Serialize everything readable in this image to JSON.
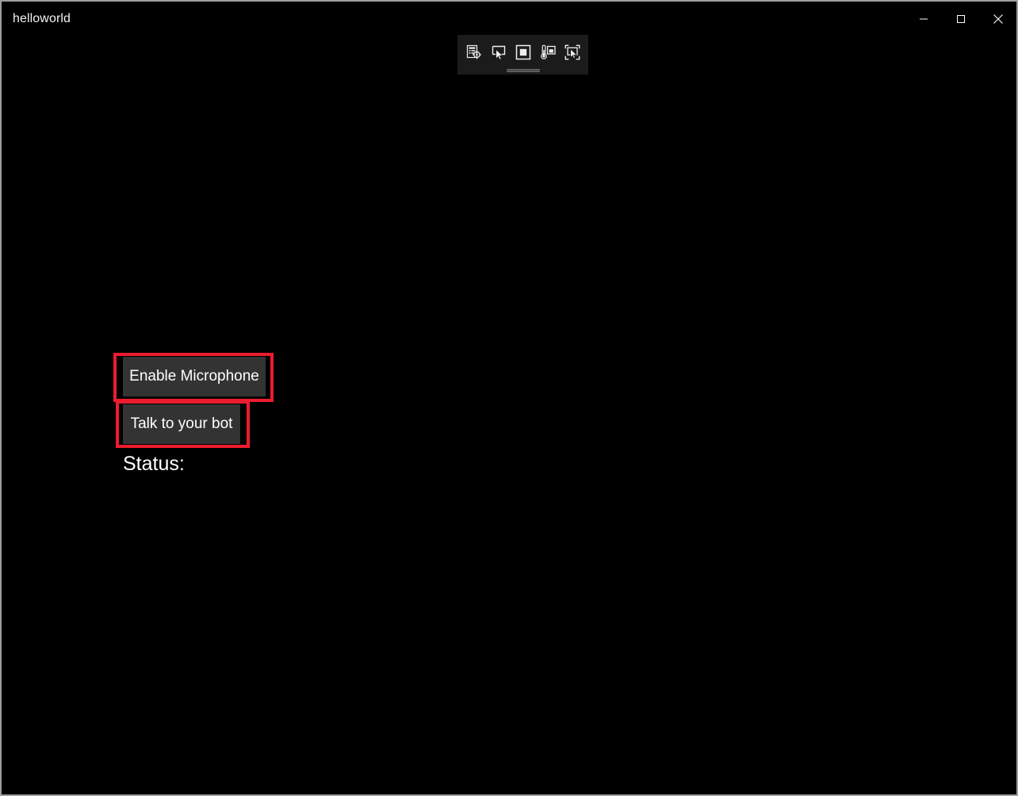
{
  "window": {
    "title": "helloworld",
    "background_color": "#000000",
    "border_color": "#9e9e9e",
    "controls": [
      {
        "name": "minimize",
        "label": "Minimize",
        "glyph": "minimize-icon"
      },
      {
        "name": "maximize",
        "label": "Maximize",
        "glyph": "maximize-icon"
      },
      {
        "name": "close",
        "label": "Close",
        "glyph": "close-icon"
      }
    ]
  },
  "xaml_toolbar": {
    "background_color": "#1b1b1b",
    "buttons": [
      {
        "name": "go-to-live-visual-tree",
        "label": "Go to Live Visual Tree",
        "icon": "live-visual-tree-icon"
      },
      {
        "name": "enable-selection",
        "label": "Enable selection",
        "icon": "pointer-select-icon"
      },
      {
        "name": "display-layout-adorners",
        "label": "Display layout adorners",
        "icon": "layout-adorners-icon"
      },
      {
        "name": "track-focused-element",
        "label": "Track focused element",
        "icon": "thermometer-window-icon"
      },
      {
        "name": "select-element-in-running-application",
        "label": "Select element in running application",
        "icon": "select-in-app-icon"
      }
    ],
    "grip_label": "Drag toolbar"
  },
  "content": {
    "buttons": [
      {
        "name": "enable-microphone",
        "label": "Enable Microphone",
        "highlighted": true,
        "highlight_color": "#ec1c2e",
        "fill_color": "#333333"
      },
      {
        "name": "talk-to-your-bot",
        "label": "Talk to your bot",
        "highlighted": true,
        "highlight_color": "#ec1c2e",
        "fill_color": "#333333"
      }
    ],
    "status": {
      "label": "Status:",
      "value": ""
    }
  }
}
